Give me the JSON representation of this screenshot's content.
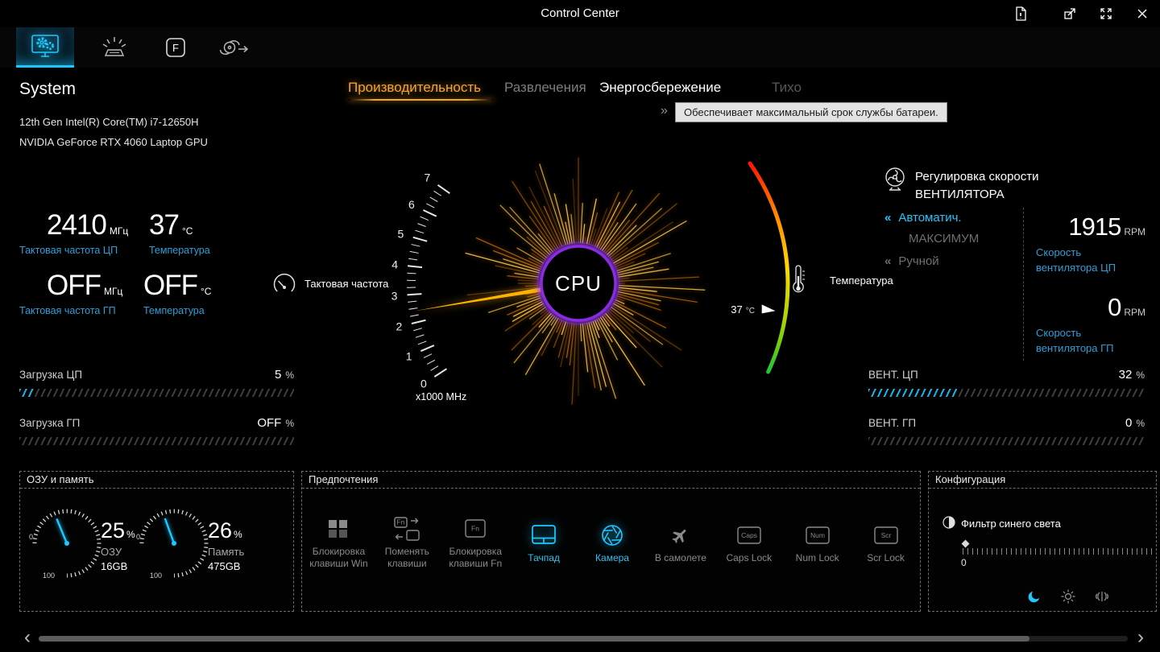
{
  "colors": {
    "accent_cyan": "#1ec8ff",
    "label_blue": "#2d9fd8",
    "active_tab_orange": "#f5a623",
    "gauge_ring_purple": "#8a2be2",
    "temp_gradient": [
      "#ff1500",
      "#ff8a00",
      "#ffd800",
      "#1fc432"
    ]
  },
  "titlebar": {
    "title": "Control Center"
  },
  "nav": {
    "tabs": [
      {
        "name": "system-monitor",
        "active": true
      },
      {
        "name": "led-backlight",
        "active": false
      },
      {
        "name": "flexikey",
        "active": false,
        "glyph": "F"
      },
      {
        "name": "fan-airflow",
        "active": false
      }
    ]
  },
  "system": {
    "title": "System",
    "cpu_name": "12th Gen Intel(R) Core(TM) i7-12650H",
    "gpu_name": "NVIDIA GeForce RTX 4060 Laptop GPU",
    "stats": [
      {
        "value": "2410",
        "unit": "МГц",
        "label": "Тактовая частота ЦП"
      },
      {
        "value": "37",
        "unit": "°C",
        "label": "Температура"
      },
      {
        "value": "OFF",
        "unit": "МГц",
        "label": "Тактовая частота ГП"
      },
      {
        "value": "OFF",
        "unit": "°C",
        "label": "Температура"
      }
    ],
    "loads": [
      {
        "label": "Загрузка ЦП",
        "value": "5",
        "unit": "%",
        "percent": 5
      },
      {
        "label": "Загрузка ГП",
        "value": "OFF",
        "unit": "%",
        "percent": 0
      }
    ]
  },
  "modes": {
    "tabs": [
      {
        "label": "Производительность",
        "state": "active"
      },
      {
        "label": "Развлечения",
        "state": "normal"
      },
      {
        "label": "Энергосбережение",
        "state": "highlight"
      },
      {
        "label": "Тихо",
        "state": "dim"
      }
    ],
    "chevron": "»",
    "tooltip": "Обеспечивает максимальный срок службы батареи."
  },
  "gauge": {
    "center_label": "CPU",
    "scale_unit": "x1000 MHz",
    "scale_min": 0,
    "scale_max": 7,
    "value_x1000mhz": 2.41,
    "tick_labels": [
      "0",
      "1",
      "2",
      "3",
      "4",
      "5",
      "6",
      "7"
    ],
    "freq_icon_label": "Тактовая частота",
    "temp_icon_label": "Температура",
    "temp_value": "37",
    "temp_unit": "°C"
  },
  "fan": {
    "title_line1": "Регулировка скорости",
    "title_line2": "ВЕНТИЛЯТОРА",
    "modes": [
      {
        "chevron": "«",
        "label": "Автоматич.",
        "active": true
      },
      {
        "chevron": "",
        "label": "МАКСИМУМ",
        "active": false
      },
      {
        "chevron": "«",
        "label": "Ручной",
        "active": false
      }
    ],
    "readings": [
      {
        "value": "1915",
        "unit": "RPM",
        "label_line1": "Скорость",
        "label_line2": "вентилятора ЦП"
      },
      {
        "value": "0",
        "unit": "RPM",
        "label_line1": "Скорость",
        "label_line2": "вентилятора ГП"
      }
    ],
    "bars": [
      {
        "label": "ВЕНТ. ЦП",
        "value": "32",
        "unit": "%",
        "percent": 32
      },
      {
        "label": "ВЕНТ. ГП",
        "value": "0",
        "unit": "%",
        "percent": 0
      }
    ]
  },
  "memory_panel": {
    "title": "ОЗУ и память",
    "gauges": [
      {
        "percent": 25,
        "value": "25",
        "unit": "%",
        "label": "ОЗУ",
        "capacity": "16GB",
        "scale_start": "0",
        "scale_end": "100"
      },
      {
        "percent": 26,
        "value": "26",
        "unit": "%",
        "label": "Память",
        "capacity": "475GB",
        "scale_start": "0",
        "scale_end": "100"
      }
    ]
  },
  "preferences": {
    "title": "Предпочтения",
    "items": [
      {
        "icon": "windows-lock-icon",
        "label": "Блокировка клавиши Win",
        "active": false
      },
      {
        "icon": "swap-keys-icon",
        "label": "Поменять клавиши",
        "active": false,
        "key_text": "Fn"
      },
      {
        "icon": "fn-lock-icon",
        "label": "Блокировка клавиши Fn",
        "active": false,
        "key_text": "Fn"
      },
      {
        "icon": "touchpad-icon",
        "label": "Тачпад",
        "active": true
      },
      {
        "icon": "camera-icon",
        "label": "Камера",
        "active": true
      },
      {
        "icon": "airplane-icon",
        "label": "В самолете",
        "active": false
      },
      {
        "icon": "caps-lock-key-icon",
        "label": "Caps Lock",
        "active": false,
        "key_text": "Caps"
      },
      {
        "icon": "num-lock-key-icon",
        "label": "Num Lock",
        "active": false,
        "key_text": "Num"
      },
      {
        "icon": "scroll-lock-key-icon",
        "label": "Scr Lock",
        "active": false,
        "key_text": "Scr"
      }
    ]
  },
  "config": {
    "title": "Конфигурация",
    "blue_light": {
      "label": "Фильтр синего света",
      "value": "0"
    },
    "footer_icons": [
      "blue-light-moon-icon",
      "brightness-icon",
      "sound-waves-icon"
    ]
  },
  "scrollbar": {
    "left": "‹",
    "right": "›"
  }
}
